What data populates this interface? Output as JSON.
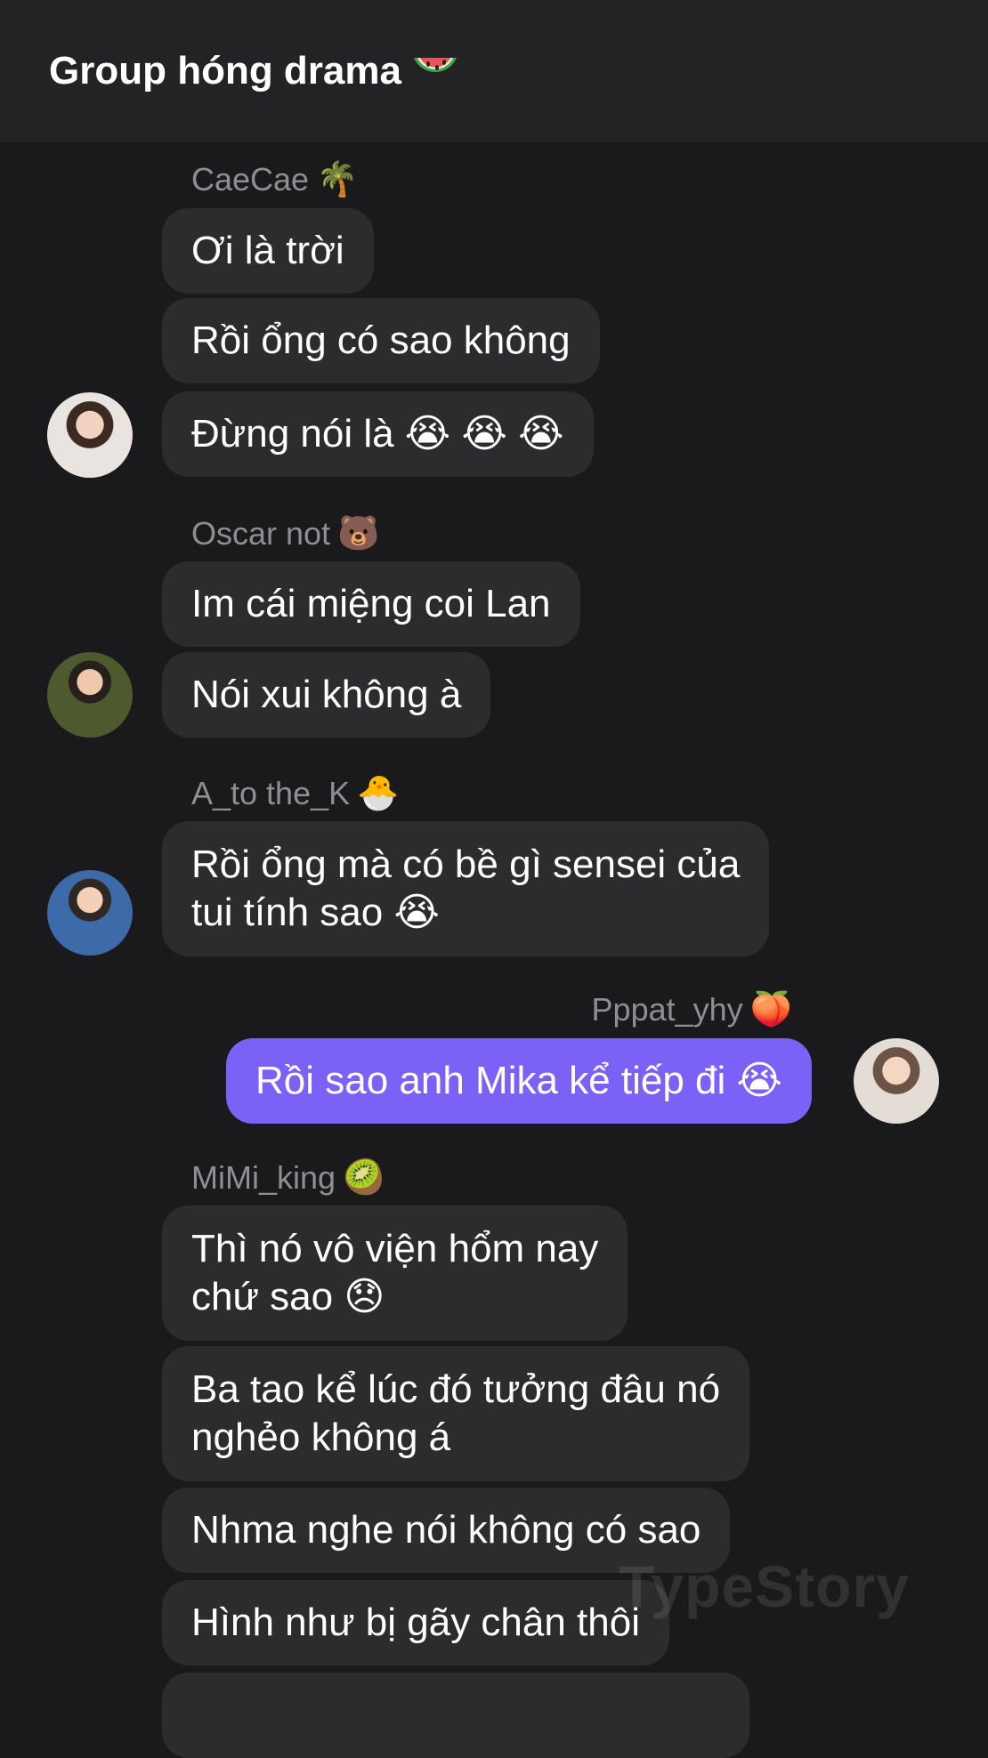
{
  "header": {
    "title": "Group hóng drama",
    "title_icon": "watermelon-icon"
  },
  "colors": {
    "background": "#1a1a1c",
    "header_bg": "#232325",
    "bubble_other": "#2c2c2e",
    "bubble_mine": "#7b61f6",
    "sender_name": "#8e8e93"
  },
  "groups": [
    {
      "sender": "CaeCae",
      "sender_emoji": "🌴",
      "messages": [
        "Ơi là trời",
        "Rồi ổng có sao không",
        "Đừng nói là 😭 😭 😭"
      ]
    },
    {
      "sender": "Oscar not",
      "sender_emoji": "🐻",
      "messages": [
        "Im cái miệng coi Lan",
        "Nói xui không à"
      ]
    },
    {
      "sender": "A_to the_K",
      "sender_emoji": "🐣",
      "messages": [
        "Rồi ổng mà có bề gì sensei của\ntui tính sao 😭"
      ]
    },
    {
      "sender": "Pppat_yhy",
      "sender_emoji": "🍑",
      "messages": [
        "Rồi sao anh Mika kể tiếp đi 😭"
      ]
    },
    {
      "sender": "MiMi_king",
      "sender_emoji": "🥝",
      "messages": [
        "Thì nó vô viện hổm nay\nchứ sao 😞",
        "Ba tao kể lúc đó tưởng đâu nó\nnghẻo không á",
        "Nhma nghe nói không có sao",
        "Hình như bị gãy chân thôi"
      ]
    }
  ],
  "watermark": "TypeStory"
}
